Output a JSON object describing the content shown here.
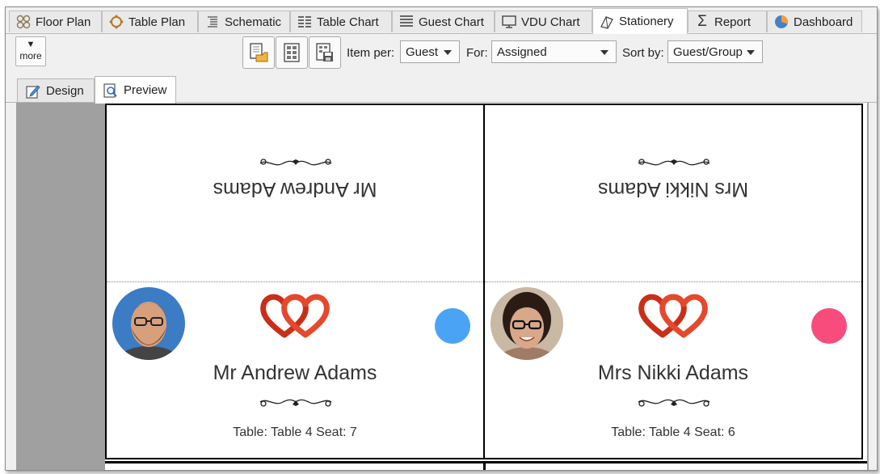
{
  "tabs": [
    {
      "label": "Floor Plan",
      "icon": "floor-plan-icon"
    },
    {
      "label": "Table Plan",
      "icon": "table-plan-icon"
    },
    {
      "label": "Schematic",
      "icon": "schematic-icon"
    },
    {
      "label": "Table Chart",
      "icon": "table-chart-icon"
    },
    {
      "label": "Guest Chart",
      "icon": "guest-chart-icon"
    },
    {
      "label": "VDU Chart",
      "icon": "vdu-chart-icon"
    },
    {
      "label": "Stationery",
      "icon": "stationery-icon",
      "active": true
    },
    {
      "label": "Report",
      "icon": "sigma-icon"
    },
    {
      "label": "Dashboard",
      "icon": "pie-icon"
    }
  ],
  "toolbar": {
    "more_label": "more",
    "item_per_label": "Item per:",
    "item_per_value": "Guest",
    "for_label": "For:",
    "for_value": "Assigned",
    "sort_by_label": "Sort by:",
    "sort_by_value": "Guest/Group"
  },
  "subtabs": [
    {
      "label": "Design",
      "icon": "design-icon"
    },
    {
      "label": "Preview",
      "icon": "preview-icon",
      "active": true
    }
  ],
  "cards": [
    {
      "name": "Mr Andrew Adams",
      "seat_text": "Table: Table 4 Seat: 7",
      "dot_color": "#4aa3f5",
      "avatar": "man-with-beard-avatar"
    },
    {
      "name": "Mrs Nikki Adams",
      "seat_text": "Table: Table 4 Seat: 6",
      "dot_color": "#f84d7c",
      "avatar": "woman-with-glasses-avatar"
    }
  ],
  "colors": {
    "heart": "#d9321e",
    "card_border": "#000000",
    "canvas_bg": "#a0a0a0"
  }
}
